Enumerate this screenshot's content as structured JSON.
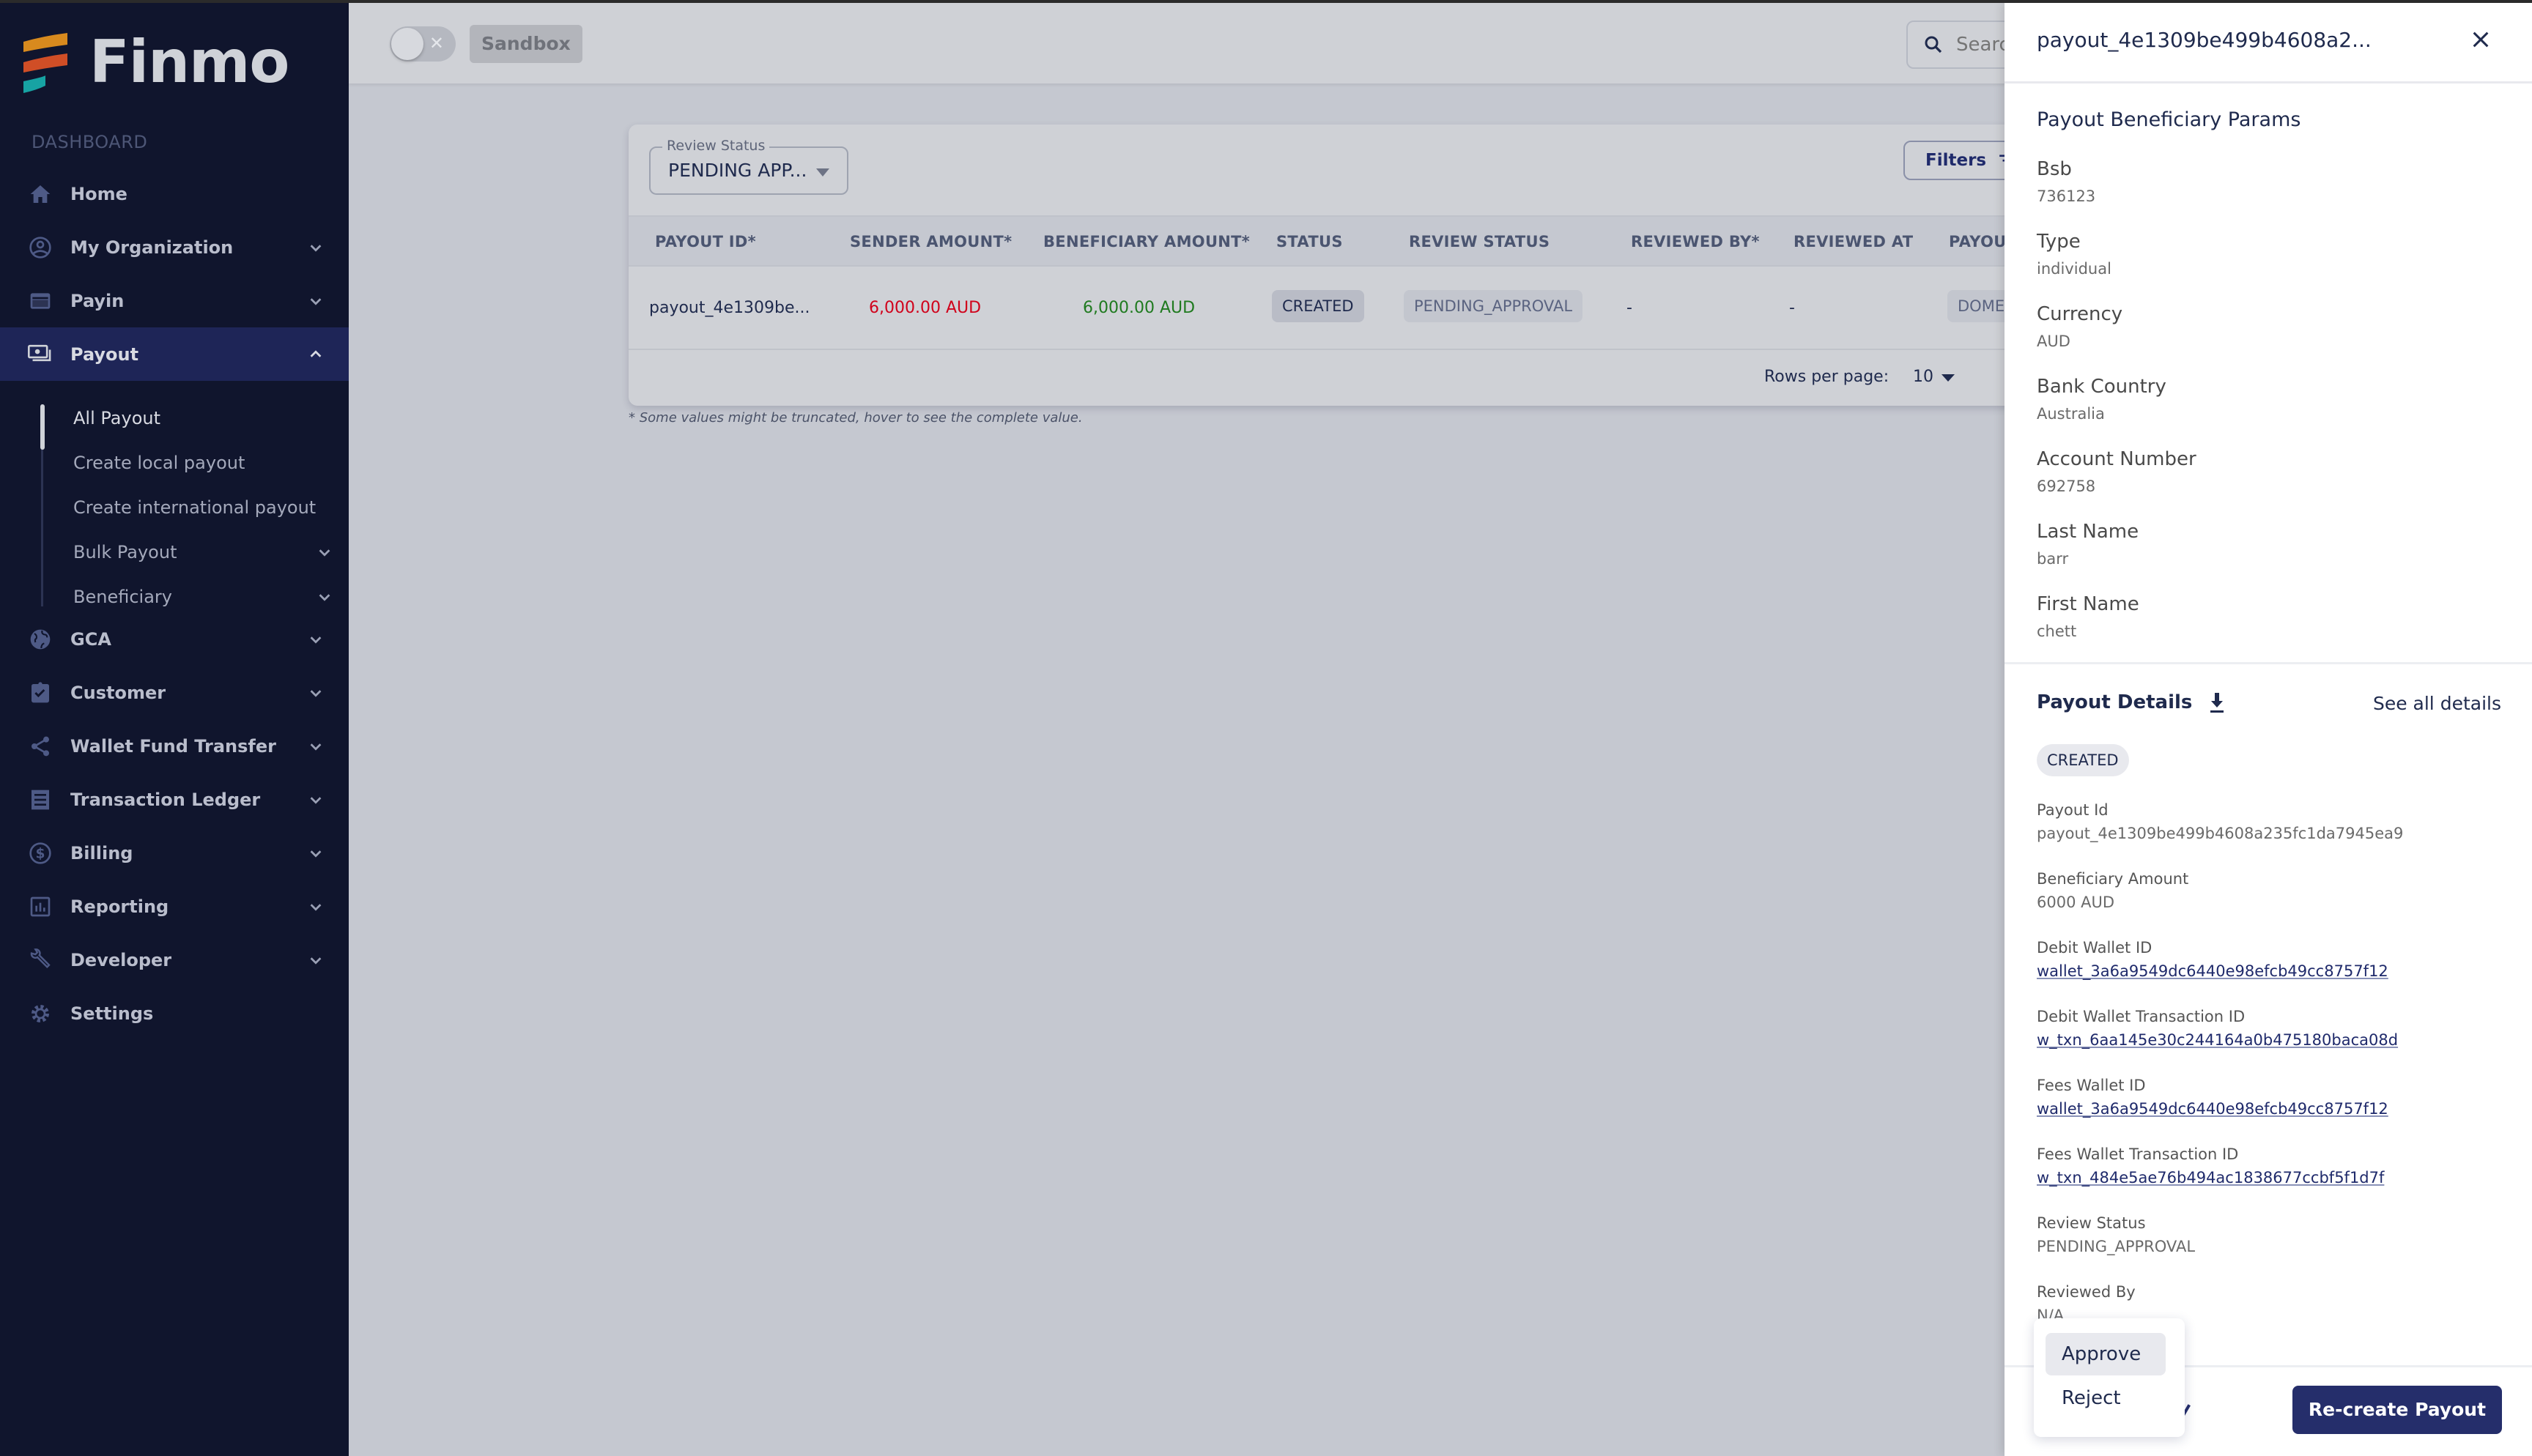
{
  "app": {
    "brand": "Finmo"
  },
  "sidebar": {
    "section_label": "DASHBOARD",
    "items": [
      {
        "label": "Home",
        "icon": "home-icon",
        "expandable": false
      },
      {
        "label": "My Organization",
        "icon": "account-circle-icon",
        "expandable": true
      },
      {
        "label": "Payin",
        "icon": "credit-card-icon",
        "expandable": true
      },
      {
        "label": "Payout",
        "icon": "payments-icon",
        "expandable": true,
        "active": true
      },
      {
        "label": "GCA",
        "icon": "globe-icon",
        "expandable": true
      },
      {
        "label": "Customer",
        "icon": "clipboard-check-icon",
        "expandable": true
      },
      {
        "label": "Wallet Fund Transfer",
        "icon": "share-icon",
        "expandable": true
      },
      {
        "label": "Transaction Ledger",
        "icon": "receipt-icon",
        "expandable": true
      },
      {
        "label": "Billing",
        "icon": "dollar-circle-icon",
        "expandable": true
      },
      {
        "label": "Reporting",
        "icon": "bar-chart-icon",
        "expandable": true
      },
      {
        "label": "Developer",
        "icon": "wrench-icon",
        "expandable": true
      },
      {
        "label": "Settings",
        "icon": "gear-icon",
        "expandable": false
      }
    ],
    "payout_sub": [
      {
        "label": "All Payout",
        "active": true
      },
      {
        "label": "Create local payout"
      },
      {
        "label": "Create international payout"
      },
      {
        "label": "Bulk Payout",
        "expandable": true
      },
      {
        "label": "Beneficiary",
        "expandable": true
      }
    ]
  },
  "topbar": {
    "environment_toggle": {
      "on": false,
      "off_glyph": "✕"
    },
    "environment_label": "Sandbox",
    "search_placeholder": "Search"
  },
  "filters": {
    "review_status_label": "Review Status",
    "review_status_value": "PENDING APP...",
    "filters_button": "Filters"
  },
  "table": {
    "columns": [
      "PAYOUT ID*",
      "SENDER AMOUNT*",
      "BENEFICIARY AMOUNT*",
      "STATUS",
      "REVIEW STATUS",
      "REVIEWED BY*",
      "REVIEWED AT",
      "PAYOU"
    ],
    "rows": [
      {
        "payout_id": "payout_4e1309be...",
        "sender_amount": "6,000.00 AUD",
        "beneficiary_amount": "6,000.00 AUD",
        "status": "CREATED",
        "review_status": "PENDING_APPROVAL",
        "reviewed_by": "-",
        "reviewed_at": "-",
        "payout_type": "DOMES"
      }
    ],
    "rows_per_page_label": "Rows per page:",
    "rows_per_page": "10",
    "footnote": "* Some values might be truncated, hover to see the complete value."
  },
  "colors": {
    "sender_amount": "#d0021b",
    "beneficiary_amount": "#1f7a1f",
    "primary": "#252e6b",
    "sidebar_bg": "#10152d"
  },
  "drawer": {
    "title": "payout_4e1309be499b4608a2...",
    "beneficiary_section_title": "Payout Beneficiary Params",
    "beneficiary_params": [
      {
        "key": "Bsb",
        "value": "736123"
      },
      {
        "key": "Type",
        "value": "individual"
      },
      {
        "key": "Currency",
        "value": "AUD"
      },
      {
        "key": "Bank Country",
        "value": "Australia"
      },
      {
        "key": "Account Number",
        "value": "692758"
      },
      {
        "key": "Last Name",
        "value": "barr"
      },
      {
        "key": "First Name",
        "value": "chett"
      }
    ],
    "details_title": "Payout Details",
    "see_all": "See all details",
    "status_badge": "CREATED",
    "details": [
      {
        "key": "Payout Id",
        "value": "payout_4e1309be499b4608a235fc1da7945ea9",
        "link": false
      },
      {
        "key": "Beneficiary Amount",
        "value": "6000 AUD",
        "link": false
      },
      {
        "key": "Debit Wallet ID",
        "value": "wallet_3a6a9549dc6440e98efcb49cc8757f12",
        "link": true
      },
      {
        "key": "Debit Wallet Transaction ID",
        "value": "w_txn_6aa145e30c244164a0b475180baca08d",
        "link": true
      },
      {
        "key": "Fees Wallet ID",
        "value": "wallet_3a6a9549dc6440e98efcb49cc8757f12",
        "link": true
      },
      {
        "key": "Fees Wallet Transaction ID",
        "value": "w_txn_484e5ae76b494ac1838677ccbf5f1d7f",
        "link": true
      },
      {
        "key": "Review Status",
        "value": "PENDING_APPROVAL",
        "link": false
      },
      {
        "key": "Reviewed By",
        "value": "N/A",
        "link": false
      }
    ],
    "review_menu": [
      "Approve",
      "Reject"
    ],
    "recreate_button": "Re-create Payout"
  }
}
